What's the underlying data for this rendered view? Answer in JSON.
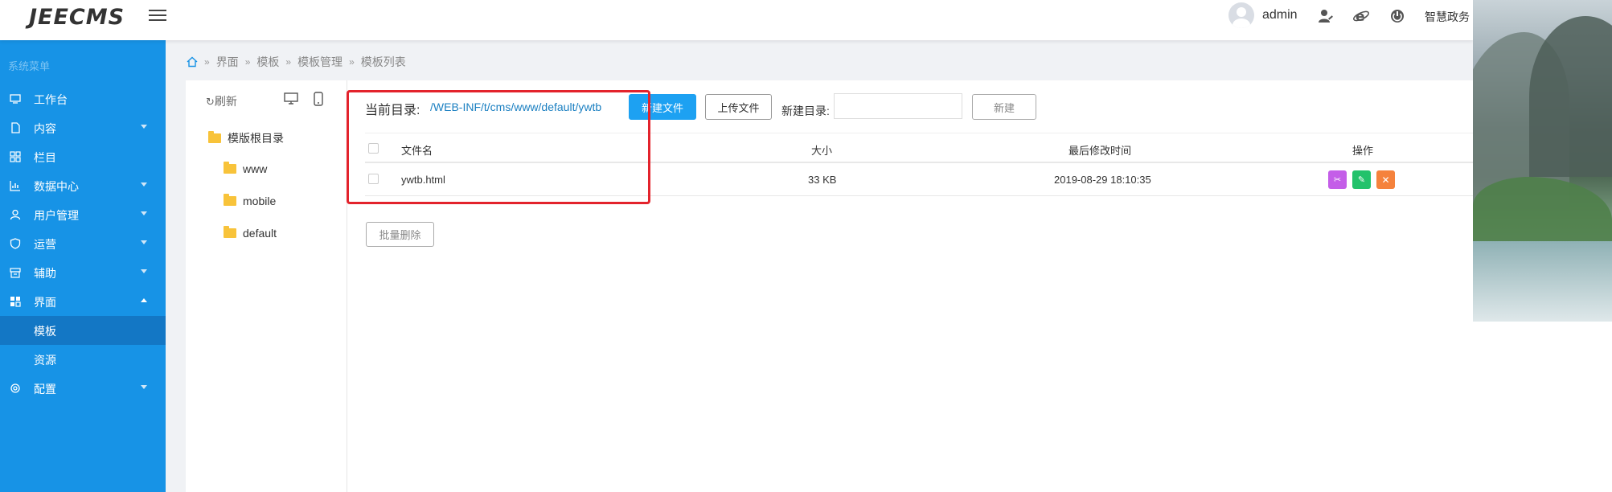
{
  "header": {
    "logo": "JEECMS",
    "username": "admin",
    "site_name": "智慧政务"
  },
  "sidebar": {
    "title": "系统菜单",
    "items": [
      {
        "label": "工作台",
        "icon": "monitor-icon",
        "arrow": "none"
      },
      {
        "label": "内容",
        "icon": "document-icon",
        "arrow": "down"
      },
      {
        "label": "栏目",
        "icon": "grid-icon",
        "arrow": "none"
      },
      {
        "label": "数据中心",
        "icon": "chart-icon",
        "arrow": "down"
      },
      {
        "label": "用户管理",
        "icon": "user-icon",
        "arrow": "down"
      },
      {
        "label": "运营",
        "icon": "shield-icon",
        "arrow": "down"
      },
      {
        "label": "辅助",
        "icon": "box-icon",
        "arrow": "down"
      },
      {
        "label": "界面",
        "icon": "layout-icon",
        "arrow": "up"
      },
      {
        "label": "模板",
        "icon": "",
        "arrow": "none",
        "active": true
      },
      {
        "label": "资源",
        "icon": "",
        "arrow": "none"
      },
      {
        "label": "配置",
        "icon": "gear-icon",
        "arrow": "down"
      }
    ]
  },
  "breadcrumb": [
    "界面",
    "模板",
    "模板管理",
    "模板列表"
  ],
  "tree": {
    "refresh_label": "刷新",
    "root_label": "模版根目录",
    "folders": [
      "www",
      "mobile",
      "default"
    ]
  },
  "toolbar": {
    "current_dir_label": "当前目录:",
    "current_dir_path": "/WEB-INF/t/cms/www/default/ywtb",
    "new_file_label": "新建文件",
    "upload_label": "上传文件",
    "new_dir_label": "新建目录:",
    "new_dir_placeholder": "",
    "create_label": "新建",
    "batch_delete_label": "批量删除"
  },
  "table": {
    "columns": [
      "文件名",
      "大小",
      "最后修改时间",
      "操作"
    ],
    "rows": [
      {
        "name": "ywtb.html",
        "size": "33 KB",
        "modified": "2019-08-29 18:10:35"
      }
    ]
  },
  "colors": {
    "sidebar_bg": "#1793e6",
    "active_menu": "#1377c5",
    "primary": "#1da1f2",
    "rename_btn": "#c45ee8",
    "edit_btn": "#23c26b",
    "delete_btn": "#f5823c",
    "highlight": "#e3232c"
  }
}
